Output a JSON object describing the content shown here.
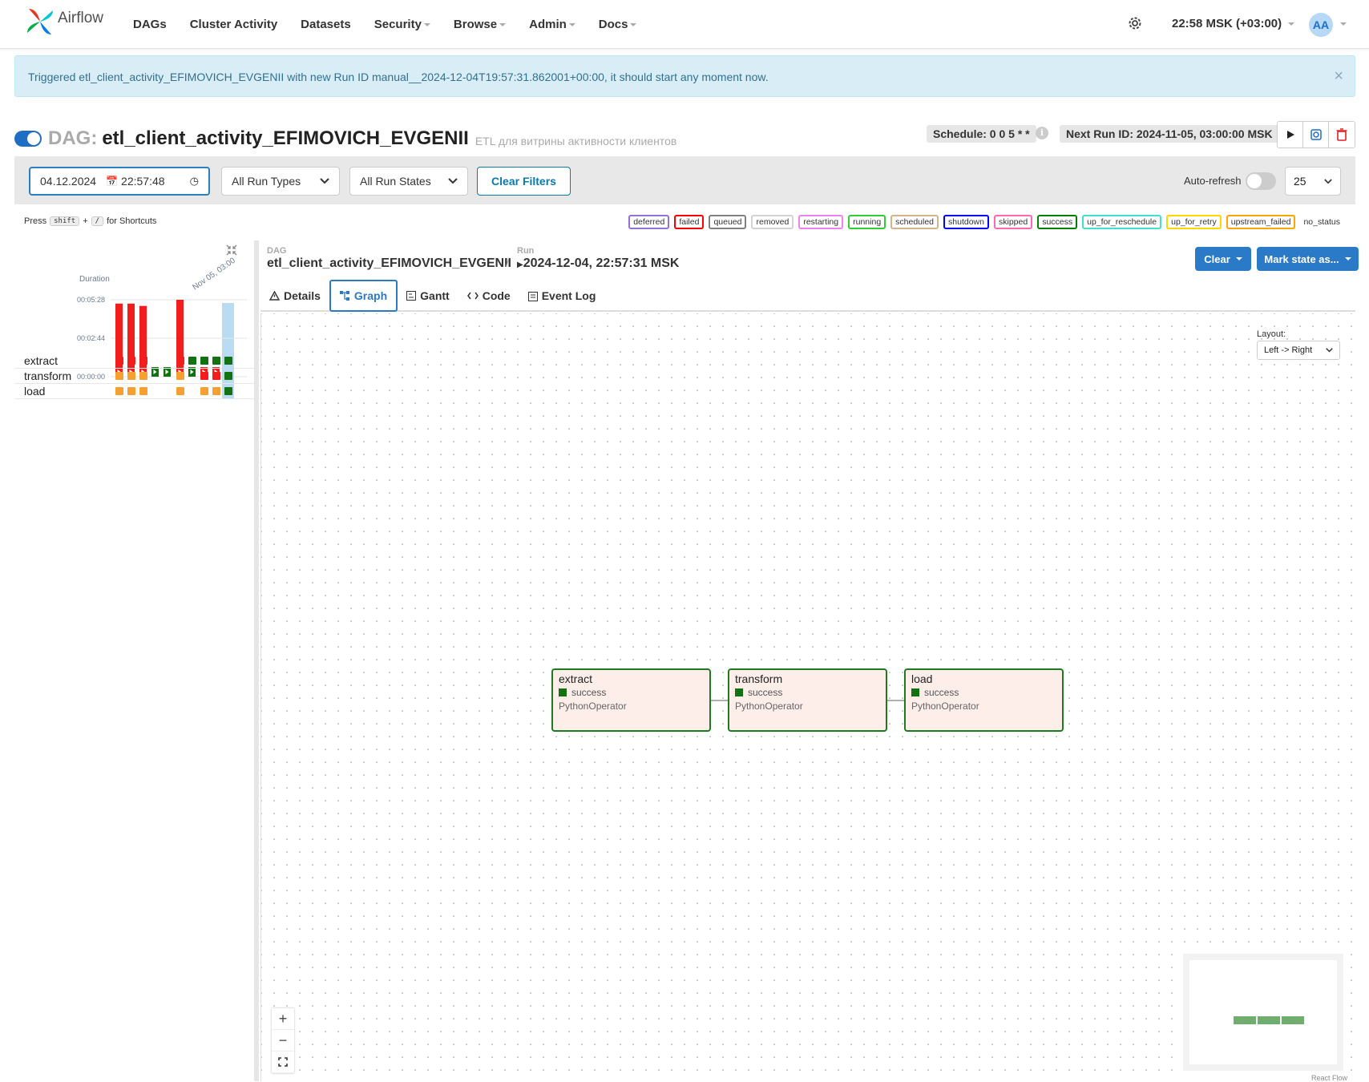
{
  "app": {
    "name": "Airflow"
  },
  "nav": {
    "items": [
      {
        "label": "DAGs",
        "dropdown": false
      },
      {
        "label": "Cluster Activity",
        "dropdown": false
      },
      {
        "label": "Datasets",
        "dropdown": false
      },
      {
        "label": "Security",
        "dropdown": true
      },
      {
        "label": "Browse",
        "dropdown": true
      },
      {
        "label": "Admin",
        "dropdown": true
      },
      {
        "label": "Docs",
        "dropdown": true
      }
    ],
    "time": "22:58 MSK (+03:00)",
    "user_initials": "AA"
  },
  "alert": {
    "message": "Triggered etl_client_activity_EFIMOVICH_EVGENII with new Run ID manual__2024-12-04T19:57:31.862001+00:00, it should start any moment now.",
    "close": "×"
  },
  "dag": {
    "label": "DAG:",
    "name": "etl_client_activity_EFIMOVICH_EVGENII",
    "description": "ETL для витрины активности клиентов",
    "schedule": "Schedule: 0 0 5 * *",
    "next_run": "Next Run ID: 2024-11-05, 03:00:00 MSK",
    "paused": false
  },
  "filters": {
    "date": "04.12.2024",
    "time": "22:57:48",
    "run_types": "All Run Types",
    "run_states": "All Run States",
    "clear_label": "Clear Filters",
    "autorefresh_label": "Auto-refresh",
    "per_page": "25"
  },
  "shortcuts": {
    "press": "Press",
    "key1": "shift",
    "plus": "+",
    "key2": "/",
    "suffix": "for Shortcuts"
  },
  "legend": [
    {
      "label": "deferred",
      "color": "#9370db"
    },
    {
      "label": "failed",
      "color": "#ff0000"
    },
    {
      "label": "queued",
      "color": "#808080"
    },
    {
      "label": "removed",
      "color": "#d3d3d3"
    },
    {
      "label": "restarting",
      "color": "#ee82ee"
    },
    {
      "label": "running",
      "color": "#32cd32"
    },
    {
      "label": "scheduled",
      "color": "#d2b48c"
    },
    {
      "label": "shutdown",
      "color": "#0000ff"
    },
    {
      "label": "skipped",
      "color": "#ff69b4"
    },
    {
      "label": "success",
      "color": "#008000"
    },
    {
      "label": "up_for_reschedule",
      "color": "#40e0d0"
    },
    {
      "label": "up_for_retry",
      "color": "#ffd700"
    },
    {
      "label": "upstream_failed",
      "color": "#ffa500"
    },
    {
      "label": "no_status",
      "color": ""
    }
  ],
  "grid": {
    "duration_label": "Duration",
    "y_ticks": [
      "00:05:28",
      "00:02:44",
      "00:00:00"
    ],
    "date_label": "Nov 05, 03:00",
    "runs": [
      {
        "state": "failed",
        "duration_frac": 0.95
      },
      {
        "state": "failed",
        "duration_frac": 0.95
      },
      {
        "state": "failed",
        "duration_frac": 0.92
      },
      {
        "state": "success",
        "duration_frac": 0.0
      },
      {
        "state": "success",
        "duration_frac": 0.0
      },
      {
        "state": "failed",
        "duration_frac": 1.0
      },
      {
        "state": "success",
        "duration_frac": 0.0
      },
      {
        "state": "failed",
        "duration_frac": 0.0
      },
      {
        "state": "failed",
        "duration_frac": 0.0
      },
      {
        "state": "success",
        "duration_frac": 0.0
      }
    ],
    "tasks": [
      {
        "name": "extract",
        "states": [
          "failed",
          "failed",
          "failed",
          "",
          "",
          "failed",
          "success",
          "success",
          "success",
          "success"
        ]
      },
      {
        "name": "transform",
        "states": [
          "upstream_failed",
          "upstream_failed",
          "upstream_failed",
          "",
          "",
          "upstream_failed",
          "",
          "failed",
          "failed",
          "success"
        ]
      },
      {
        "name": "load",
        "states": [
          "upstream_failed",
          "upstream_failed",
          "upstream_failed",
          "",
          "",
          "upstream_failed",
          "",
          "upstream_failed",
          "upstream_failed",
          "success"
        ]
      }
    ]
  },
  "breadcrumb": {
    "dag_label": "DAG",
    "dag_name": "etl_client_activity_EFIMOVICH_EVGENII",
    "separator": "/",
    "run_label": "Run",
    "run_value": "2024-12-04, 22:57:31 MSK"
  },
  "actions": {
    "clear": "Clear",
    "mark_state": "Mark state as..."
  },
  "tabs": [
    {
      "label": "Details",
      "icon": "warning-icon"
    },
    {
      "label": "Graph",
      "icon": "graph-icon",
      "active": true
    },
    {
      "label": "Gantt",
      "icon": "gantt-icon"
    },
    {
      "label": "Code",
      "icon": "code-icon"
    },
    {
      "label": "Event Log",
      "icon": "log-icon"
    }
  ],
  "graph": {
    "layout_label": "Layout:",
    "layout_value": "Left -> Right",
    "nodes": [
      {
        "name": "extract",
        "state": "success",
        "operator": "PythonOperator"
      },
      {
        "name": "transform",
        "state": "success",
        "operator": "PythonOperator"
      },
      {
        "name": "load",
        "state": "success",
        "operator": "PythonOperator"
      }
    ],
    "attribution": "React Flow",
    "zoom_in": "+",
    "zoom_out": "−"
  },
  "colors": {
    "failed": "#f21d1d",
    "success": "#127212",
    "upstream_failed": "#f5a030",
    "accent": "#2b7ac7"
  }
}
